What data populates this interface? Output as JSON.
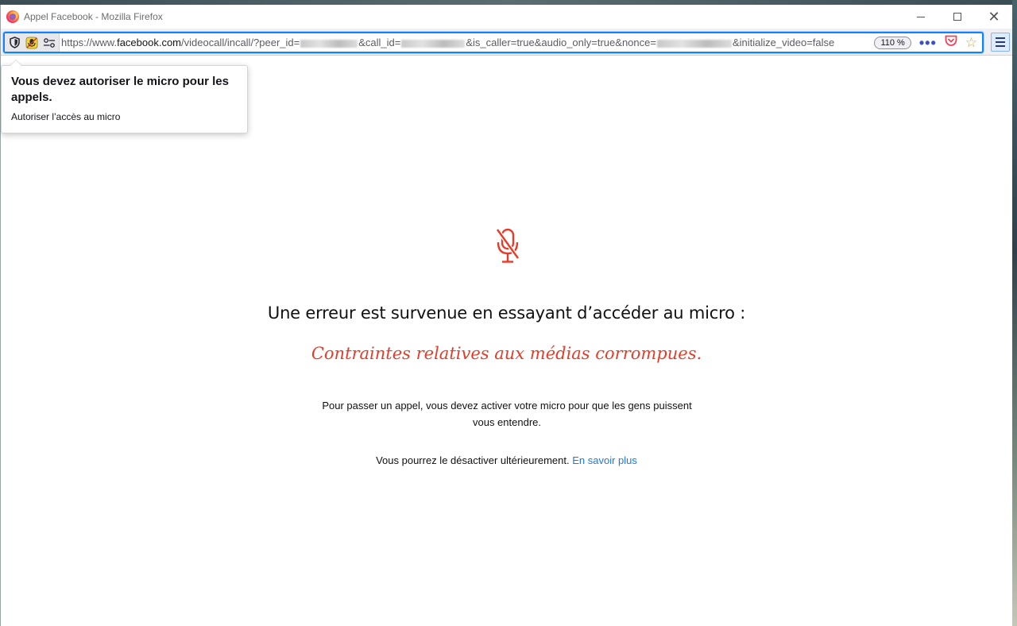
{
  "window": {
    "title": "Appel Facebook - Mozilla Firefox"
  },
  "urlbar": {
    "scheme": "https://www.",
    "host": "facebook.com",
    "p1": "/videocall/incall/?peer_id=",
    "p2": "&call_id=",
    "p3": "&is_caller=true&audio_only=true&nonce=",
    "p4": "&initialize_video=false",
    "zoom": "110 %"
  },
  "popup": {
    "title": "Vous devez autoriser le micro pour les appels.",
    "subtitle": "Autoriser l’accès au micro"
  },
  "error": {
    "heading": "Une erreur est survenue en essayant d’accéder au micro :",
    "detail": "Contraintes relatives aux médias corrompues.",
    "explanation": "Pour passer un appel, vous devez activer votre micro pour que les gens puissent vous entendre.",
    "footer": "Vous pourrez le désactiver ultérieurement.",
    "learn_more": "En savoir plus"
  },
  "colors": {
    "error_red": "#e63b28",
    "link_blue": "#1877f2",
    "focus_blue": "#0a84ff"
  },
  "icons": {
    "browser": "firefox-logo-icon",
    "tracking": "shield-icon",
    "permission": "microphone-blocked-icon",
    "permissions_panel": "permissions-icon",
    "page_actions": "more-icon",
    "pocket": "pocket-icon",
    "bookmark": "star-icon",
    "menu": "hamburger-icon",
    "main": "microphone-muted-icon"
  }
}
